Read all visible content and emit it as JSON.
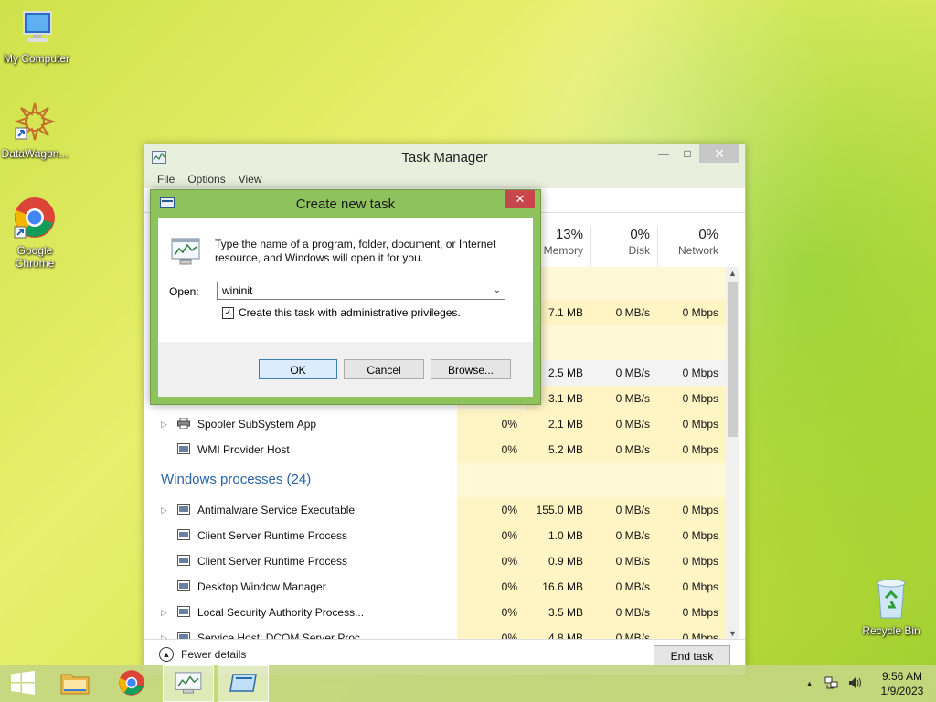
{
  "desktop": {
    "icons": [
      {
        "label": "My Computer"
      },
      {
        "label": "DataWagon..."
      },
      {
        "label": "Google Chrome"
      },
      {
        "label": "Recycle Bin"
      }
    ]
  },
  "task_manager": {
    "title": "Task Manager",
    "menu": [
      "File",
      "Options",
      "View"
    ],
    "columns": [
      {
        "pct": "13%",
        "label": "Memory"
      },
      {
        "pct": "0%",
        "label": "Disk"
      },
      {
        "pct": "0%",
        "label": "Network"
      }
    ],
    "rows_top": [
      {
        "mem": "7.1 MB",
        "disk": "0 MB/s",
        "net": "0 Mbps"
      },
      {
        "mem": "2.5 MB",
        "disk": "0 MB/s",
        "net": "0 Mbps"
      },
      {
        "mem": "3.1 MB",
        "disk": "0 MB/s",
        "net": "0 Mbps"
      }
    ],
    "rows_bg": [
      {
        "name": "Spooler SubSystem App",
        "cpu": "0%",
        "mem": "2.1 MB",
        "disk": "0 MB/s",
        "net": "0 Mbps",
        "expand": true
      },
      {
        "name": "WMI Provider Host",
        "cpu": "0%",
        "mem": "5.2 MB",
        "disk": "0 MB/s",
        "net": "0 Mbps",
        "expand": false
      }
    ],
    "group_windows": "Windows processes (24)",
    "rows_win": [
      {
        "name": "Antimalware Service Executable",
        "cpu": "0%",
        "mem": "155.0 MB",
        "disk": "0 MB/s",
        "net": "0 Mbps",
        "expand": true
      },
      {
        "name": "Client Server Runtime Process",
        "cpu": "0%",
        "mem": "1.0 MB",
        "disk": "0 MB/s",
        "net": "0 Mbps",
        "expand": false
      },
      {
        "name": "Client Server Runtime Process",
        "cpu": "0%",
        "mem": "0.9 MB",
        "disk": "0 MB/s",
        "net": "0 Mbps",
        "expand": false
      },
      {
        "name": "Desktop Window Manager",
        "cpu": "0%",
        "mem": "16.6 MB",
        "disk": "0 MB/s",
        "net": "0 Mbps",
        "expand": false
      },
      {
        "name": "Local Security Authority Process...",
        "cpu": "0%",
        "mem": "3.5 MB",
        "disk": "0 MB/s",
        "net": "0 Mbps",
        "expand": true
      },
      {
        "name": "Service Host: DCOM Server Proc...",
        "cpu": "0%",
        "mem": "4.8 MB",
        "disk": "0 MB/s",
        "net": "0 Mbps",
        "expand": true
      }
    ],
    "fewer_details": "Fewer details",
    "end_task": "End task"
  },
  "dialog": {
    "title": "Create new task",
    "message": "Type the name of a program, folder, document, or Internet resource, and Windows will open it for you.",
    "open_label": "Open:",
    "open_value": "wininit",
    "admin_label": "Create this task with administrative privileges.",
    "admin_checked": true,
    "ok": "OK",
    "cancel": "Cancel",
    "browse": "Browse..."
  },
  "taskbar": {
    "time": "9:56 AM",
    "date": "1/9/2023"
  }
}
